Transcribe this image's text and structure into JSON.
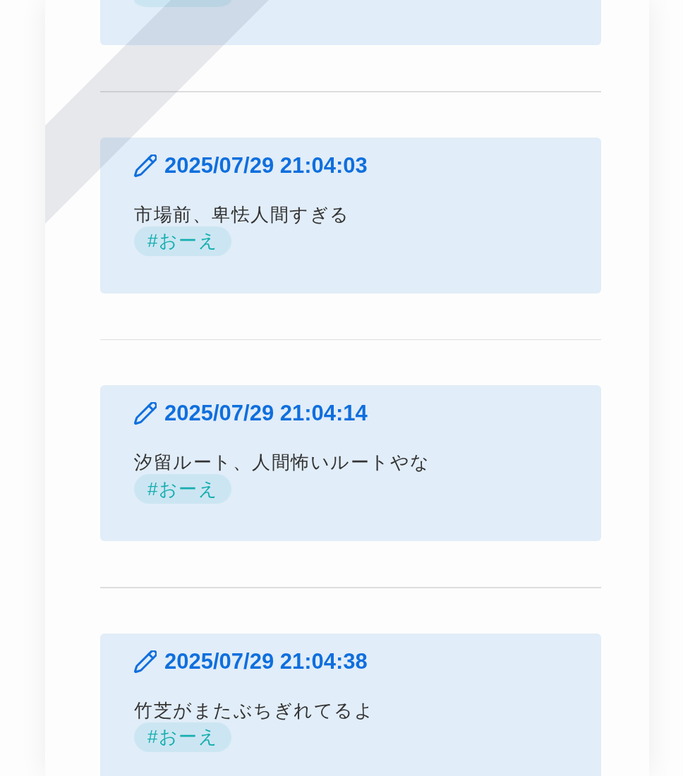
{
  "posts": [
    {
      "kind": "partial"
    },
    {
      "kind": "full",
      "timestamp": "2025/07/29 21:04:03",
      "text": "市場前、卑怯人間すぎる",
      "tags": [
        "#おーえ"
      ]
    },
    {
      "kind": "full",
      "timestamp": "2025/07/29 21:04:14",
      "text": "汐留ルート、人間怖いルートやな",
      "tags": [
        "#おーえ"
      ]
    },
    {
      "kind": "full",
      "timestamp": "2025/07/29 21:04:38",
      "text": "竹芝がまたぶちぎれてるよ",
      "tags": [
        "#おーえ"
      ]
    }
  ]
}
